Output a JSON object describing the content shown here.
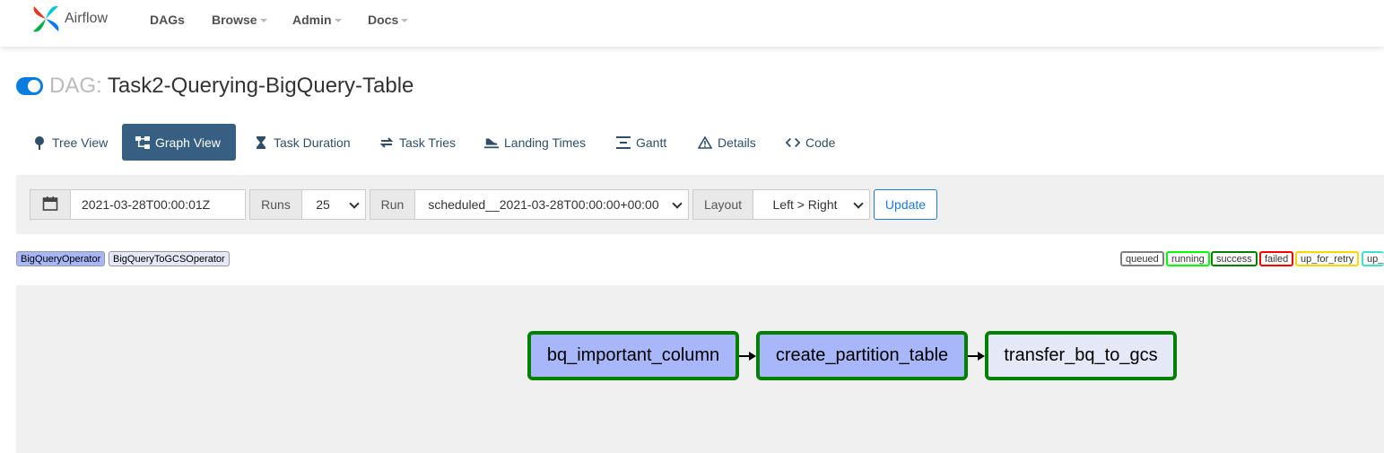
{
  "app": {
    "brand": "Airflow"
  },
  "nav": {
    "items": [
      {
        "label": "DAGs"
      },
      {
        "label": "Browse"
      },
      {
        "label": "Admin"
      },
      {
        "label": "Docs"
      }
    ]
  },
  "dag": {
    "prefix": "DAG:",
    "name": "Task2-Querying-BigQuery-Table",
    "paused": false
  },
  "tabs": [
    {
      "label": "Tree View",
      "icon": "tree-icon"
    },
    {
      "label": "Graph View",
      "icon": "graph-icon",
      "active": true
    },
    {
      "label": "Task Duration",
      "icon": "hourglass-icon"
    },
    {
      "label": "Task Tries",
      "icon": "retry-icon"
    },
    {
      "label": "Landing Times",
      "icon": "landing-icon"
    },
    {
      "label": "Gantt",
      "icon": "gantt-icon"
    },
    {
      "label": "Details",
      "icon": "warning-icon"
    },
    {
      "label": "Code",
      "icon": "code-icon"
    }
  ],
  "controls": {
    "base_date": "2021-03-28T00:00:01Z",
    "runs_label": "Runs",
    "runs_value": "25",
    "run_label": "Run",
    "run_value": "scheduled__2021-03-28T00:00:00+00:00",
    "layout_label": "Layout",
    "layout_value": "Left > Right",
    "update_label": "Update"
  },
  "operator_legend": [
    {
      "label": "BigQueryOperator",
      "color": "#a7b7f9"
    },
    {
      "label": "BigQueryToGCSOperator",
      "color": "#e4e8f7"
    }
  ],
  "state_legend": [
    {
      "label": "queued",
      "color": "#808080"
    },
    {
      "label": "running",
      "color": "#00ff00"
    },
    {
      "label": "success",
      "color": "#008000"
    },
    {
      "label": "failed",
      "color": "#ff0000"
    },
    {
      "label": "up_for_retry",
      "color": "#ffd700"
    },
    {
      "label": "up_t",
      "color": "#40e0d0"
    }
  ],
  "graph": {
    "nodes": [
      {
        "id": "bq_important_column",
        "operator": "BigQueryOperator",
        "state": "success",
        "fill": "#a7b7f9"
      },
      {
        "id": "create_partition_table",
        "operator": "BigQueryOperator",
        "state": "success",
        "fill": "#a7b7f9"
      },
      {
        "id": "transfer_bq_to_gcs",
        "operator": "BigQueryToGCSOperator",
        "state": "success",
        "fill": "#e4e8f7"
      }
    ],
    "edges": [
      {
        "from": "bq_important_column",
        "to": "create_partition_table"
      },
      {
        "from": "create_partition_table",
        "to": "transfer_bq_to_gcs"
      }
    ]
  }
}
